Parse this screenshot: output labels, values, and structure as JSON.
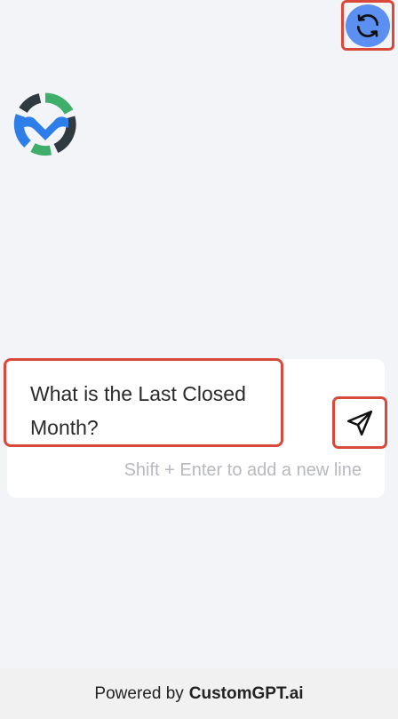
{
  "header": {
    "refresh_icon": "refresh-icon",
    "refresh_bg_color": "#5b8ff2"
  },
  "branding": {
    "logo_icon": "customgpt-logo"
  },
  "composer": {
    "message": "What is the Last Closed Month?",
    "hint": "Shift + Enter to add a new line",
    "send_icon": "send-icon"
  },
  "footer": {
    "powered_by": "Powered by",
    "brand": "CustomGPT.ai"
  },
  "colors": {
    "highlight": "#d9493a",
    "background": "#f3f4f8"
  }
}
